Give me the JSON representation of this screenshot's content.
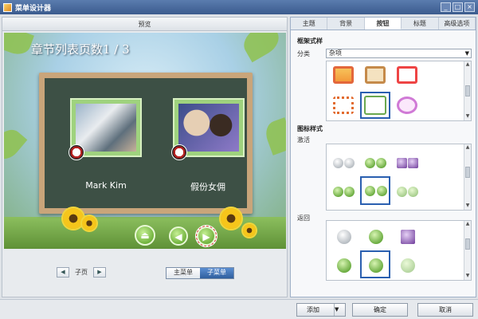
{
  "window": {
    "title": "菜单设计器",
    "controls": [
      "_",
      "□",
      "×"
    ]
  },
  "preview": {
    "header": "预览",
    "stage_title": "章节列表页数1 / 3",
    "items": [
      {
        "label": "Mark Kim"
      },
      {
        "label": "假份女佣"
      }
    ],
    "pager": {
      "prev": "◀",
      "label": "子页",
      "next": "▶"
    },
    "menu_toggle": {
      "main": "主菜单",
      "sub": "子菜单",
      "active": "sub"
    }
  },
  "right_panel": {
    "tabs": [
      "主题",
      "背景",
      "按钮",
      "标题",
      "高级选项"
    ],
    "active_tab": "按钮",
    "frame_style": {
      "title": "框架式样",
      "category_label": "分类",
      "category_value": "杂项"
    },
    "icon_style": {
      "title": "图标样式",
      "active_label": "激活",
      "return_label": "返回"
    }
  },
  "bottom_bar": {
    "add": "添加",
    "ok": "确定",
    "cancel": "取消"
  },
  "colors": {
    "accent": "#2a5fb0",
    "title_bar": "#3b5b8e",
    "green_button": "#4e9a1a"
  }
}
